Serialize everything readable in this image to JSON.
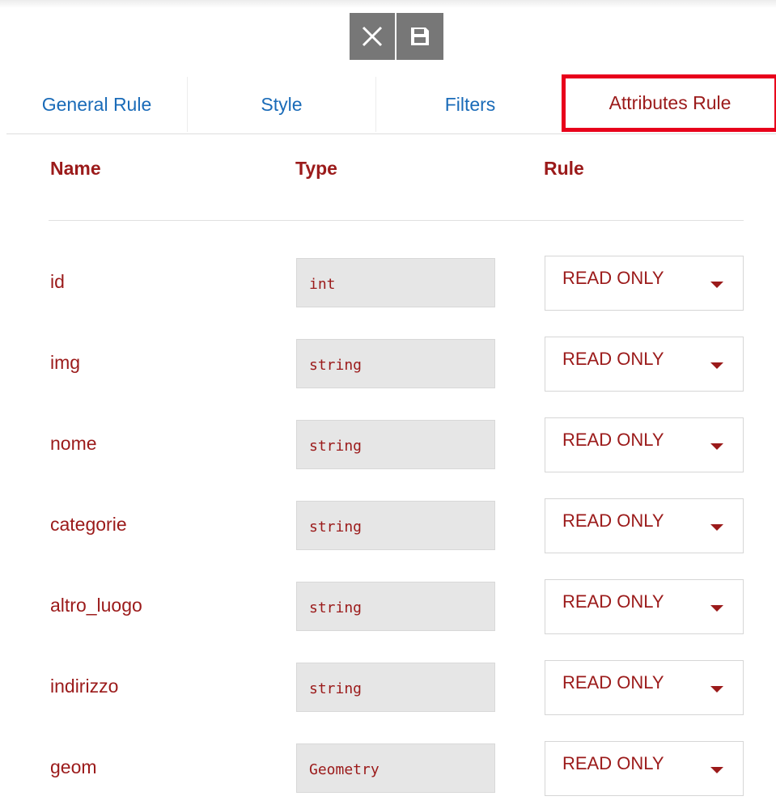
{
  "toolbar": {
    "close_icon": "close-icon",
    "save_icon": "floppy-disk-icon",
    "button_color": "#777777"
  },
  "tabs": [
    {
      "label": "General Rule"
    },
    {
      "label": "Style"
    },
    {
      "label": "Filters"
    },
    {
      "label": "Attributes Rule",
      "active": true
    }
  ],
  "table": {
    "headers": {
      "name": "Name",
      "type": "Type",
      "rule": "Rule"
    },
    "rows": [
      {
        "name": "id",
        "type": "int",
        "rule": "READ ONLY"
      },
      {
        "name": "img",
        "type": "string",
        "rule": "READ ONLY"
      },
      {
        "name": "nome",
        "type": "string",
        "rule": "READ ONLY"
      },
      {
        "name": "categorie",
        "type": "string",
        "rule": "READ ONLY"
      },
      {
        "name": "altro_luogo",
        "type": "string",
        "rule": "READ ONLY"
      },
      {
        "name": "indirizzo",
        "type": "string",
        "rule": "READ ONLY"
      },
      {
        "name": "geom",
        "type": "Geometry",
        "rule": "READ ONLY"
      }
    ]
  },
  "colors": {
    "tab_link": "#1a6bb8",
    "text_accent": "#9b1a1a",
    "highlight_border": "#e8001b",
    "field_bg": "#e6e6e6"
  }
}
